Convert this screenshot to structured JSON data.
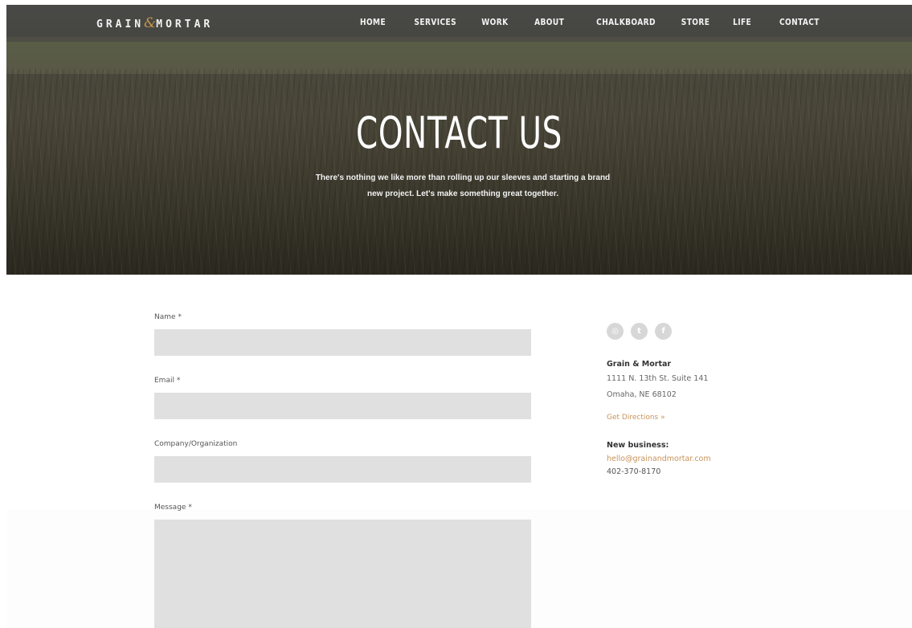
{
  "header": {
    "logo_left": "GRAIN",
    "logo_amp": "&",
    "logo_right": "MORTAR",
    "nav": [
      "HOME",
      "SERVICES",
      "WORK",
      "ABOUT",
      "CHALKBOARD",
      "STORE",
      "LIFE",
      "CONTACT"
    ]
  },
  "hero": {
    "title": "CONTACT US",
    "subtitle_line1": "There's nothing we like more than rolling up our sleeves and starting a brand",
    "subtitle_line2": "new project. Let's make something great together."
  },
  "form": {
    "name_label": "Name",
    "email_label": "Email",
    "company_label": "Company/Organization",
    "message_label": "Message",
    "required_mark": "*"
  },
  "sidebar": {
    "social": [
      {
        "icon": "instagram-icon",
        "glyph": "◎"
      },
      {
        "icon": "twitter-icon",
        "glyph": "t"
      },
      {
        "icon": "facebook-icon",
        "glyph": "f"
      }
    ],
    "company": "Grain & Mortar",
    "address_line1": "1111 N. 13th St. Suite 141",
    "address_line2": "Omaha, NE 68102",
    "directions": "Get Directions »",
    "new_business_label": "New business:",
    "email": "hello@grainandmortar.com",
    "phone": "402-370-8170"
  },
  "colors": {
    "accent": "#c8935a",
    "field_bg": "#e0e0e0"
  }
}
